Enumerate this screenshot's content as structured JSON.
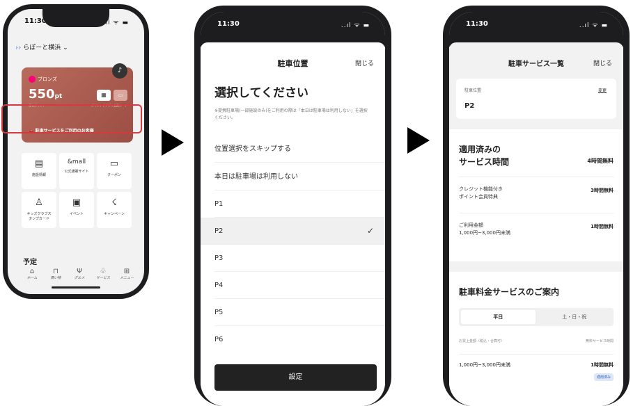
{
  "phone1": {
    "time": "11:30",
    "status_icons": "..ıl ᯤ ▬",
    "mall": "らぽーと横浜",
    "mall_prefix": "I·I·",
    "rank": "ブロンズ",
    "points": "550",
    "points_unit": "pt",
    "points_label": "保有ポイント",
    "card_label": "ポイント / アプリ会員カード",
    "parking": "駐車サービスをご利用のお客様",
    "tiles": [
      {
        "icon": "▤",
        "label": "施設情報"
      },
      {
        "icon": "&mall",
        "label": "公式通販サイト"
      },
      {
        "icon": "▭",
        "label": "クーポン"
      },
      {
        "icon": "♙",
        "label": "キッズクラブス\nタンプカード"
      },
      {
        "icon": "▣",
        "label": "イベント"
      },
      {
        "icon": "☇",
        "label": "キャンペーン"
      }
    ],
    "schedule": "予定",
    "tabs": [
      {
        "icon": "⌂",
        "label": "ホーム"
      },
      {
        "icon": "⊓",
        "label": "買い物"
      },
      {
        "icon": "Ψ",
        "label": "グルメ"
      },
      {
        "icon": "♧",
        "label": "サービス"
      },
      {
        "icon": "⊞",
        "label": "メニュー"
      }
    ]
  },
  "phone2": {
    "time": "11:30",
    "title": "駐車位置",
    "close": "閉じる",
    "heading": "選択してください",
    "note": "※提携駐車場(一部施設のみ)をご利用の際は「本日は駐車場は利用しない」を選択ください。",
    "options": [
      "位置選択をスキップする",
      "本日は駐車場は利用しない",
      "P1",
      "P2",
      "P3",
      "P4",
      "P5",
      "P6"
    ],
    "selected": "P2",
    "button": "設定"
  },
  "phone3": {
    "time": "11:30",
    "title": "駐車サービス一覧",
    "close": "閉じる",
    "pos_label": "駐車位置",
    "change": "変更",
    "pos_value": "P2",
    "applied_heading": "適用済みの\nサービス時間",
    "applied_total": "4時間無料",
    "rows": [
      {
        "label": "クレジット機能付き\nポイント会員特典",
        "value": "3時間無料"
      },
      {
        "label": "ご利用金額\n1,000円~3,000円未満",
        "value": "1時間無料"
      }
    ],
    "guide_heading": "駐車料金サービスのご案内",
    "seg_on": "平日",
    "seg_off": "土・日・祝",
    "th_left": "お買上金額（税込・合算可）",
    "th_right": "無料サービス時間",
    "tr_left": "1,000円~3,000円未満",
    "tr_right": "1時間無料",
    "badge": "適用済み"
  }
}
